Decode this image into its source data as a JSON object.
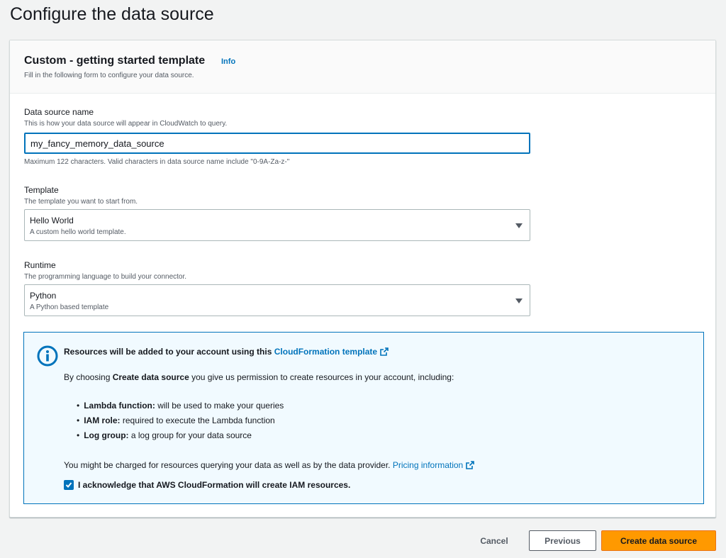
{
  "page": {
    "title": "Configure the data source"
  },
  "panel": {
    "heading": "Custom - getting started template",
    "info_link": "Info",
    "description": "Fill in the following form to configure your data source."
  },
  "form": {
    "data_source_name": {
      "label": "Data source name",
      "description": "This is how your data source will appear in CloudWatch to query.",
      "value": "my_fancy_memory_data_source",
      "constraint": "Maximum 122 characters. Valid characters in data source name include \"0-9A-Za-z-\""
    },
    "template": {
      "label": "Template",
      "description": "The template you want to start from.",
      "selected": "Hello World",
      "selected_description": "A custom hello world template."
    },
    "runtime": {
      "label": "Runtime",
      "description": "The programming language to build your connector.",
      "selected": "Python",
      "selected_description": "A Python based template"
    }
  },
  "alert": {
    "title_prefix": "Resources will be added to your account using this",
    "title_link": "CloudFormation template",
    "intro_prefix": "By choosing",
    "intro_bold": "Create data source",
    "intro_suffix": "you give us permission to create resources in your account, including:",
    "resources": [
      {
        "name": "Lambda function:",
        "text": "will be used to make your queries"
      },
      {
        "name": "IAM role:",
        "text": "required to execute the Lambda function"
      },
      {
        "name": "Log group:",
        "text": "a log group for your data source"
      }
    ],
    "charges_text": "You might be charged for resources querying your data as well as by the data provider.",
    "pricing_link": "Pricing information",
    "acknowledge_label": "I acknowledge that AWS CloudFormation will create IAM resources.",
    "acknowledge_checked": true
  },
  "footer": {
    "cancel": "Cancel",
    "previous": "Previous",
    "create": "Create data source"
  },
  "colors": {
    "link": "#0073bb",
    "primary_button": "#ff9900",
    "alert_background": "#f1faff"
  }
}
